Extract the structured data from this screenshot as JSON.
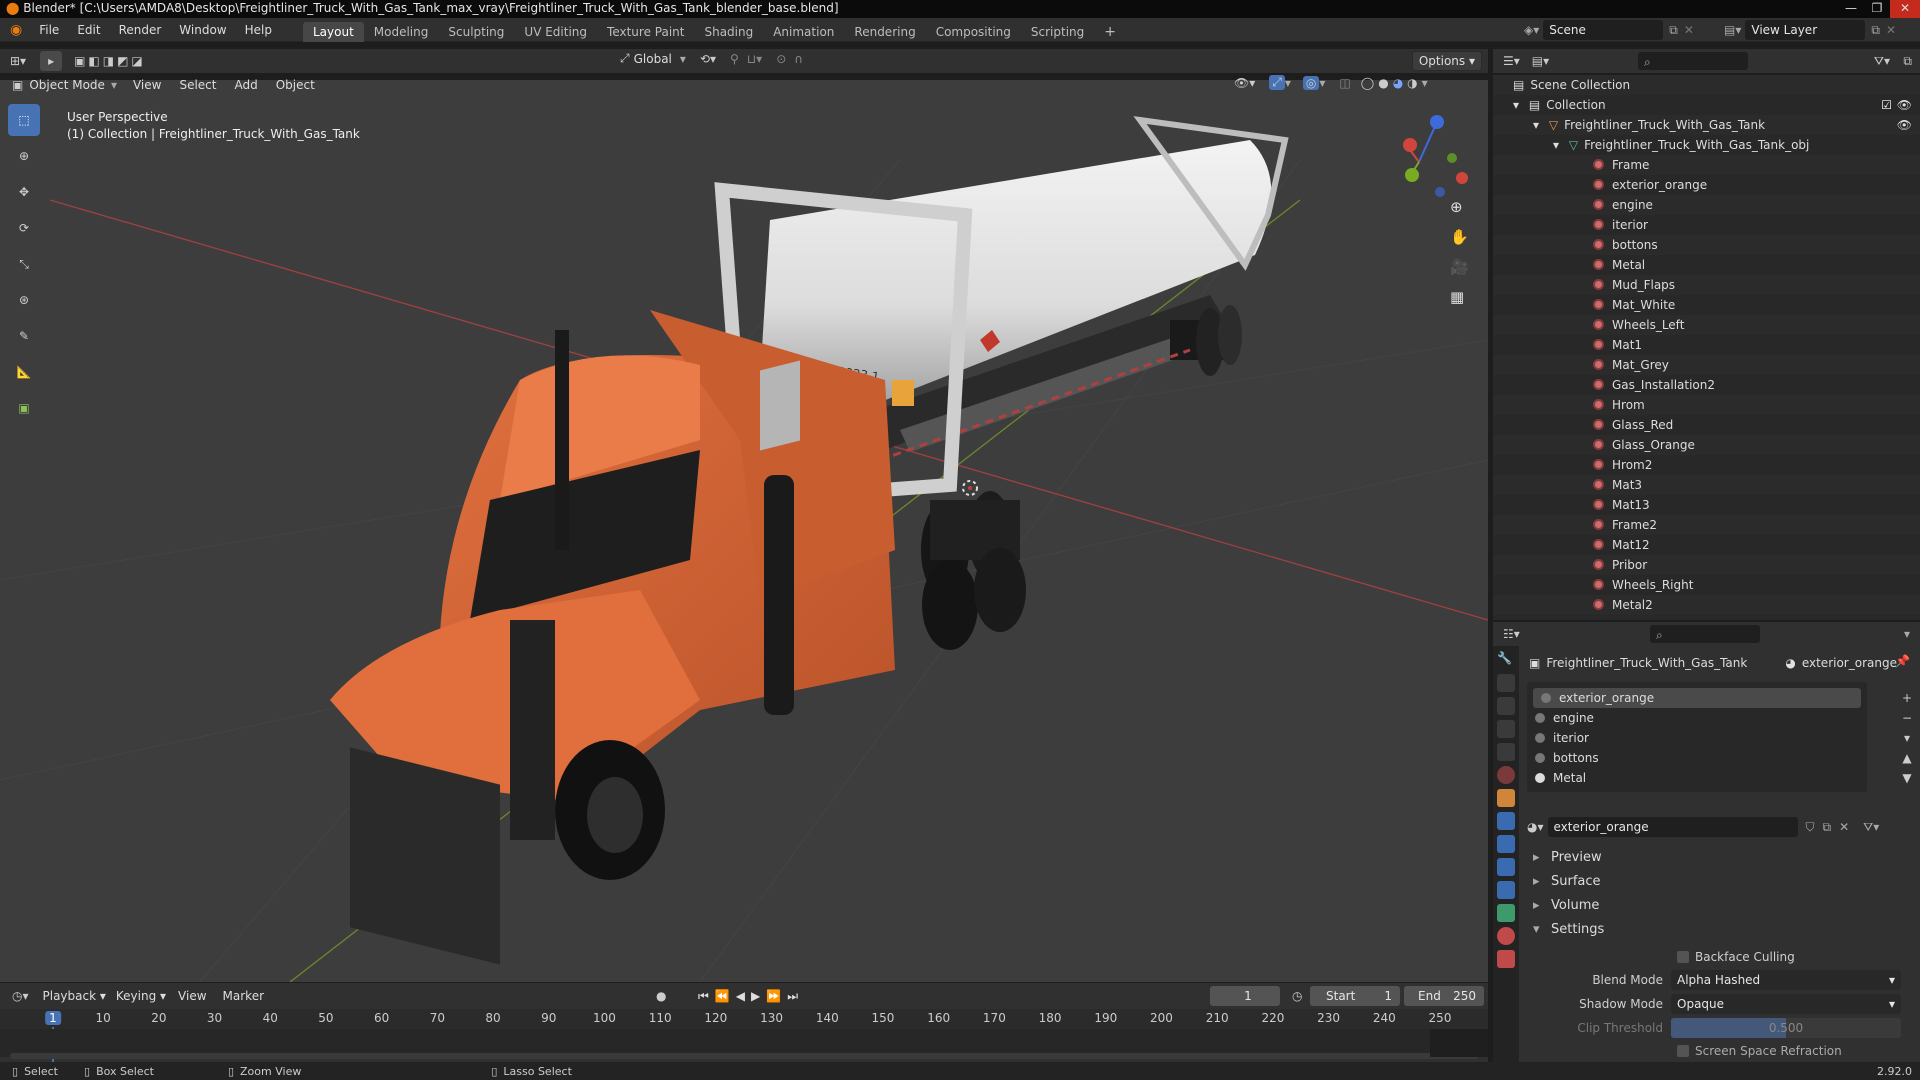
{
  "window": {
    "title": "Blender* [C:\\Users\\AMDA8\\Desktop\\Freightliner_Truck_With_Gas_Tank_max_vray\\Freightliner_Truck_With_Gas_Tank_blender_base.blend]"
  },
  "menu": [
    "File",
    "Edit",
    "Render",
    "Window",
    "Help"
  ],
  "workspaces": [
    "Layout",
    "Modeling",
    "Sculpting",
    "UV Editing",
    "Texture Paint",
    "Shading",
    "Animation",
    "Rendering",
    "Compositing",
    "Scripting"
  ],
  "active_workspace": "Layout",
  "scene": {
    "label": "Scene",
    "view_layer": "View Layer"
  },
  "viewport_header": {
    "transform_orientation": "Global",
    "options": "Options",
    "mode": "Object Mode",
    "menus": [
      "View",
      "Select",
      "Add",
      "Object"
    ]
  },
  "viewport": {
    "perspective": "User Perspective",
    "collection_info": "(1) Collection | Freightliner_Truck_With_Gas_Tank",
    "tank_label": "P50 IS0023 1"
  },
  "outliner": {
    "scene_collection": "Scene Collection",
    "collection": "Collection",
    "object": "Freightliner_Truck_With_Gas_Tank",
    "mesh": "Freightliner_Truck_With_Gas_Tank_obj",
    "materials": [
      "Frame",
      "exterior_orange",
      "engine",
      "iterior",
      "bottons",
      "Metal",
      "Mud_Flaps",
      "Mat_White",
      "Wheels_Left",
      "Mat1",
      "Mat_Grey",
      "Gas_Installation2",
      "Hrom",
      "Glass_Red",
      "Glass_Orange",
      "Hrom2",
      "Mat3",
      "Mat13",
      "Frame2",
      "Mat12",
      "Pribor",
      "Wheels_Right",
      "Metal2"
    ]
  },
  "properties": {
    "breadcrumb_object": "Freightliner_Truck_With_Gas_Tank",
    "breadcrumb_material": "exterior_orange",
    "slots": [
      "exterior_orange",
      "engine",
      "iterior",
      "bottons",
      "Metal"
    ],
    "active_material": "exterior_orange",
    "panels": [
      "Preview",
      "Surface",
      "Volume",
      "Settings"
    ],
    "settings": {
      "backface_culling_label": "Backface Culling",
      "blend_mode_label": "Blend Mode",
      "blend_mode": "Alpha Hashed",
      "shadow_mode_label": "Shadow Mode",
      "shadow_mode": "Opaque",
      "clip_threshold_label": "Clip Threshold",
      "clip_threshold": "0.500",
      "ssr_label": "Screen Space Refraction"
    }
  },
  "timeline": {
    "menus": [
      "Playback",
      "Keying",
      "View",
      "Marker"
    ],
    "current_frame": "1",
    "start_label": "Start",
    "start": "1",
    "end_label": "End",
    "end": "250",
    "ruler": [
      "1",
      "10",
      "20",
      "30",
      "40",
      "50",
      "60",
      "70",
      "80",
      "90",
      "100",
      "110",
      "120",
      "130",
      "140",
      "150",
      "160",
      "170",
      "180",
      "190",
      "200",
      "210",
      "220",
      "230",
      "240",
      "250"
    ]
  },
  "statusbar": {
    "items": [
      "Select",
      "Box Select",
      "Zoom View",
      "Lasso Select"
    ],
    "version": "2.92.0"
  },
  "colors": {
    "accent": "#4772b3",
    "truck_orange": "#d9643a",
    "tank_white": "#e4e4e4",
    "viewport_bg": "#3d3d3d"
  }
}
